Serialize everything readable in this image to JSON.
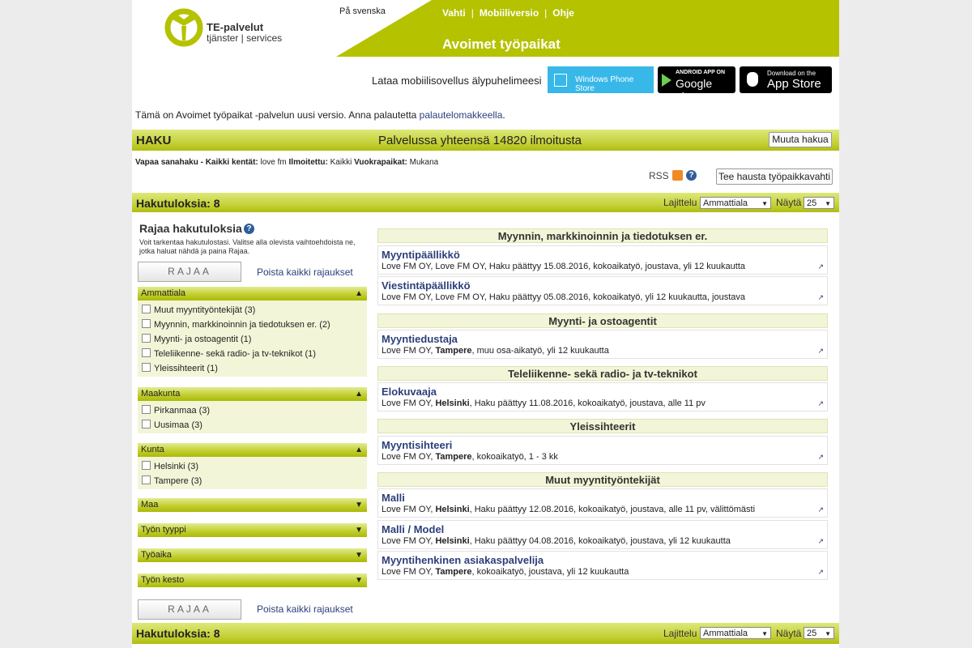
{
  "header": {
    "logo_line1": "TE-palvelut",
    "logo_line2": "tjänster | services",
    "lang_link": "På svenska",
    "nav": [
      "Vahti",
      "Mobiiliversio",
      "Ohje"
    ],
    "site_title": "Avoimet työpaikat",
    "brand_color": "#b5c200"
  },
  "apps": {
    "prompt": "Lataa mobiilisovellus älypuhelimeesi",
    "windows": "Windows Phone Store",
    "google_small": "ANDROID APP ON",
    "google_big": "Google play",
    "apple_small": "Download on the",
    "apple_big": "App Store"
  },
  "notice": {
    "text": "Tämä on Avoimet työpaikat -palvelun uusi versio. Anna palautetta ",
    "link": "palautelomakkeella",
    "end": "."
  },
  "haku": {
    "title": "HAKU",
    "total": "Palvelussa yhteensä 14820 ilmoitusta",
    "modify": "Muuta hakua"
  },
  "criteria": {
    "l1": "Vapaa sanahaku - Kaikki kentät:",
    "v1": " love fm ",
    "l2": "Ilmoitettu:",
    "v2": " Kaikki ",
    "l3": "Vuokrapaikat:",
    "v3": " Mukana"
  },
  "rss": "RSS",
  "watch_button": "Tee hausta työpaikkavahti",
  "results_bar": {
    "count": "Hakutuloksia: 8",
    "sort_label": "Lajittelu",
    "sort_value": "Ammattiala",
    "show_label": "Näytä",
    "show_value": "25"
  },
  "sidebar": {
    "title": "Rajaa hakutuloksia",
    "desc": "Voit tarkentaa hakutulostasi. Valitse alla olevista vaihtoehdoista ne, jotka haluat nähdä ja paina Rajaa.",
    "rajaa": "RAJAA",
    "clear": "Poista kaikki rajaukset",
    "groups": [
      {
        "title": "Ammattiala",
        "items": [
          "Muut myyntityöntekijät (3)",
          "Myynnin, markkinoinnin ja tiedotuksen er. (2)",
          "Myynti- ja ostoagentit (1)",
          "Teleliikenne- sekä radio- ja tv-teknikot (1)",
          "Yleissihteerit (1)"
        ]
      },
      {
        "title": "Maakunta",
        "items": [
          "Pirkanmaa (3)",
          "Uusimaa (3)"
        ]
      },
      {
        "title": "Kunta",
        "items": [
          "Helsinki (3)",
          "Tampere (3)"
        ]
      },
      {
        "title": "Maa",
        "items": []
      },
      {
        "title": "Työn tyyppi",
        "items": []
      },
      {
        "title": "Työaika",
        "items": []
      },
      {
        "title": "Työn kesto",
        "items": []
      }
    ]
  },
  "categories": [
    {
      "name": "Myynnin, markkinoinnin ja tiedotuksen er.",
      "jobs": [
        {
          "title": "Myyntipäällikkö",
          "pre": "Love FM OY, Love FM OY, Haku päättyy 15.08.2016, kokoaikatyö, joustava, yli 12 kuukautta",
          "city": "",
          "post": ""
        },
        {
          "title": "Viestintäpäällikkö",
          "pre": "Love FM OY, Love FM OY, Haku päättyy 05.08.2016, kokoaikatyö, yli 12 kuukautta, joustava",
          "city": "",
          "post": ""
        }
      ]
    },
    {
      "name": "Myynti- ja ostoagentit",
      "jobs": [
        {
          "title": "Myyntiedustaja",
          "pre": "Love FM OY, ",
          "city": "Tampere",
          "post": ", muu osa-aikatyö, yli 12 kuukautta"
        }
      ]
    },
    {
      "name": "Teleliikenne- sekä radio- ja tv-teknikot",
      "jobs": [
        {
          "title": "Elokuvaaja",
          "pre": "Love FM OY, ",
          "city": "Helsinki",
          "post": ", Haku päättyy 11.08.2016, kokoaikatyö, joustava, alle 11 pv"
        }
      ]
    },
    {
      "name": "Yleissihteerit",
      "jobs": [
        {
          "title": "Myyntisihteeri",
          "pre": "Love FM OY, ",
          "city": "Tampere",
          "post": ", kokoaikatyö, 1 - 3 kk"
        }
      ]
    },
    {
      "name": "Muut myyntityöntekijät",
      "jobs": [
        {
          "title": "Malli",
          "pre": "Love FM OY, ",
          "city": "Helsinki",
          "post": ", Haku päättyy 12.08.2016, kokoaikatyö, joustava, alle 11 pv, välittömästi"
        },
        {
          "title": "Malli / Model",
          "pre": "Love FM OY, ",
          "city": "Helsinki",
          "post": ", Haku päättyy 04.08.2016, kokoaikatyö, joustava, yli 12 kuukautta"
        },
        {
          "title": "Myyntihenkinen asiakaspalvelija",
          "pre": "Love FM OY, ",
          "city": "Tampere",
          "post": ", kokoaikatyö, joustava, yli 12 kuukautta"
        }
      ]
    }
  ]
}
